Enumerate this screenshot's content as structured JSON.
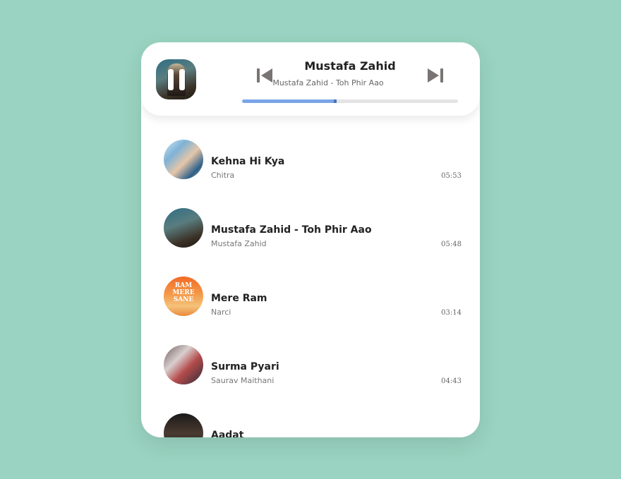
{
  "now_playing": {
    "title": "Mustafa Zahid",
    "subtitle": "Mustafa Zahid - Toh Phir Aao",
    "progress_fraction": 0.43
  },
  "controls": {
    "pause_icon": "pause-icon",
    "prev_icon": "skip-previous-icon",
    "next_icon": "skip-next-icon",
    "accent_color": "#7aa6e8"
  },
  "songs": [
    {
      "title": "Kehna Hi Kya",
      "artist": "Chitra",
      "duration": "05:53"
    },
    {
      "title": "Mustafa Zahid - Toh Phir Aao",
      "artist": "Mustafa Zahid",
      "duration": "05:48"
    },
    {
      "title": "Mere Ram",
      "artist": "Narci",
      "duration": "03:14",
      "cover_text": "RAM MERE SANE"
    },
    {
      "title": "Surma Pyari",
      "artist": "Saurav Maithani",
      "duration": "04:43"
    },
    {
      "title": "Aadat",
      "artist": "",
      "duration": ""
    }
  ]
}
